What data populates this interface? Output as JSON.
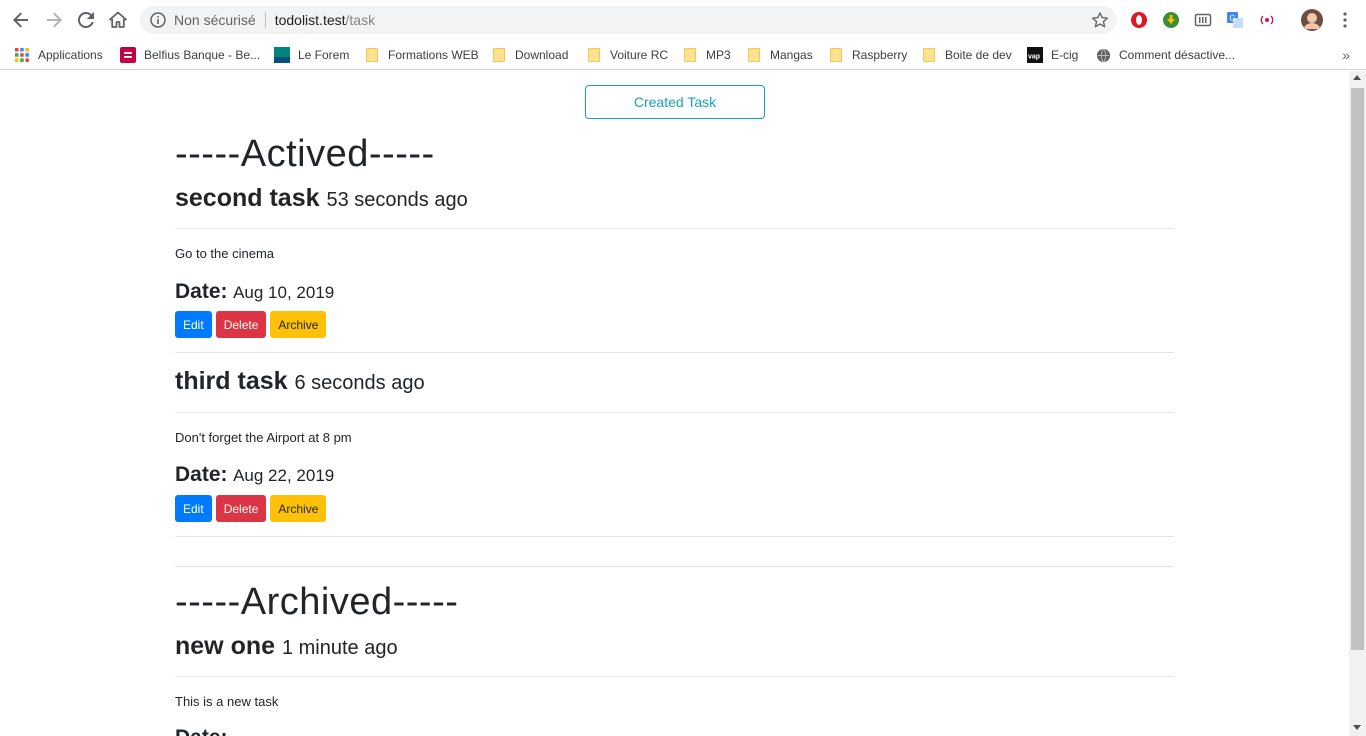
{
  "browser": {
    "security_label": "Non sécurisé",
    "url_host": "todolist.test",
    "url_path": "/task",
    "bookmarks": [
      {
        "label": "Applications",
        "icon": "apps-grid-icon"
      },
      {
        "label": "Belfius Banque - Be...",
        "icon": "belfius-icon"
      },
      {
        "label": "Le Forem",
        "icon": "forem-icon"
      },
      {
        "label": "Formations WEB",
        "icon": "folder-icon"
      },
      {
        "label": "Download",
        "icon": "folder-icon"
      },
      {
        "label": "Voiture RC",
        "icon": "folder-icon"
      },
      {
        "label": "MP3",
        "icon": "folder-icon"
      },
      {
        "label": "Mangas",
        "icon": "folder-icon"
      },
      {
        "label": "Raspberry",
        "icon": "folder-icon"
      },
      {
        "label": "Boite de dev",
        "icon": "folder-icon"
      },
      {
        "label": "E-cig",
        "icon": "vap-icon"
      },
      {
        "label": "Comment désactive...",
        "icon": "globe-icon"
      }
    ],
    "bookmarks_more": "»"
  },
  "page": {
    "create_button": "Created Task",
    "active_section": {
      "title": "-----Actived-----",
      "tasks": [
        {
          "title": "second task",
          "time": "53 seconds ago",
          "description": "Go to the cinema",
          "date_label": "Date:",
          "date": "Aug 10, 2019"
        },
        {
          "title": "third task",
          "time": "6 seconds ago",
          "description": "Don't forget the Airport at 8 pm",
          "date_label": "Date:",
          "date": "Aug 22, 2019"
        }
      ]
    },
    "archived_section": {
      "title": "-----Archived-----",
      "tasks": [
        {
          "title": "new one",
          "time": "1 minute ago",
          "description": "This is a new task",
          "date_label": "Date:"
        }
      ]
    },
    "buttons": {
      "edit": "Edit",
      "delete": "Delete",
      "archive": "Archive"
    }
  },
  "colors": {
    "edit": "#007bff",
    "delete": "#dc3545",
    "archive": "#ffc107",
    "outline_info": "#17a2b8"
  }
}
